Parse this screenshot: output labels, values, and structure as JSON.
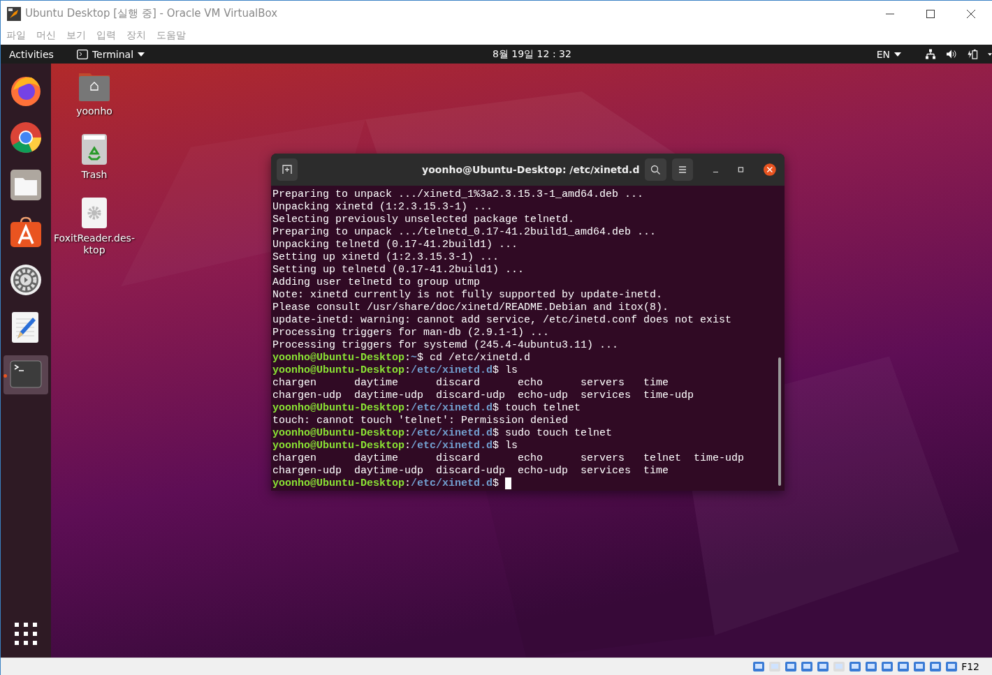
{
  "window": {
    "title": "Ubuntu Desktop [실행 중] - Oracle VM VirtualBox"
  },
  "menu": [
    "파일",
    "머신",
    "보기",
    "입력",
    "장치",
    "도움말"
  ],
  "top_bar": {
    "activities": "Activities",
    "app_menu": "Terminal",
    "clock": "8월 19일  12 : 32",
    "language": "EN"
  },
  "dock": [
    {
      "kind": "firefox",
      "selected": false
    },
    {
      "kind": "chrome",
      "selected": false
    },
    {
      "kind": "files",
      "selected": false
    },
    {
      "kind": "software",
      "selected": false
    },
    {
      "kind": "settings",
      "selected": false
    },
    {
      "kind": "editor",
      "selected": false
    },
    {
      "kind": "terminal",
      "selected": true
    }
  ],
  "desktop_icons": [
    {
      "kind": "home",
      "label": "yoonho"
    },
    {
      "kind": "trash",
      "label": "Trash"
    },
    {
      "kind": "file",
      "label": "FoxitReader.des-ktop"
    }
  ],
  "terminal": {
    "title": "yoonho@Ubuntu-Desktop: /etc/xinetd.d",
    "lines": [
      {
        "kind": "output",
        "text": "Preparing to unpack .../xinetd_1%3a2.3.15.3-1_amd64.deb ..."
      },
      {
        "kind": "output",
        "text": "Unpacking xinetd (1:2.3.15.3-1) ..."
      },
      {
        "kind": "output",
        "text": "Selecting previously unselected package telnetd."
      },
      {
        "kind": "output",
        "text": "Preparing to unpack .../telnetd_0.17-41.2build1_amd64.deb ..."
      },
      {
        "kind": "output",
        "text": "Unpacking telnetd (0.17-41.2build1) ..."
      },
      {
        "kind": "output",
        "text": "Setting up xinetd (1:2.3.15.3-1) ..."
      },
      {
        "kind": "output",
        "text": "Setting up telnetd (0.17-41.2build1) ..."
      },
      {
        "kind": "output",
        "text": "Adding user telnetd to group utmp"
      },
      {
        "kind": "output",
        "text": "Note: xinetd currently is not fully supported by update-inetd."
      },
      {
        "kind": "output",
        "text": "Please consult /usr/share/doc/xinetd/README.Debian and itox(8)."
      },
      {
        "kind": "output",
        "text": "update-inetd: warning: cannot add service, /etc/inetd.conf does not exist"
      },
      {
        "kind": "output",
        "text": "Processing triggers for man-db (2.9.1-1) ..."
      },
      {
        "kind": "output",
        "text": "Processing triggers for systemd (245.4-4ubuntu3.11) ..."
      },
      {
        "kind": "prompt",
        "user": "yoonho@Ubuntu-Desktop",
        "separator": ":",
        "path": "~",
        "command": "$ cd /etc/xinetd.d"
      },
      {
        "kind": "prompt",
        "user": "yoonho@Ubuntu-Desktop",
        "separator": ":",
        "path": "/etc/xinetd.d",
        "command": "$ ls"
      },
      {
        "kind": "output",
        "text": "chargen      daytime      discard      echo      servers   time"
      },
      {
        "kind": "output",
        "text": "chargen-udp  daytime-udp  discard-udp  echo-udp  services  time-udp"
      },
      {
        "kind": "prompt",
        "user": "yoonho@Ubuntu-Desktop",
        "separator": ":",
        "path": "/etc/xinetd.d",
        "command": "$ touch telnet"
      },
      {
        "kind": "output",
        "text": "touch: cannot touch 'telnet': Permission denied"
      },
      {
        "kind": "prompt",
        "user": "yoonho@Ubuntu-Desktop",
        "separator": ":",
        "path": "/etc/xinetd.d",
        "command": "$ sudo touch telnet"
      },
      {
        "kind": "prompt",
        "user": "yoonho@Ubuntu-Desktop",
        "separator": ":",
        "path": "/etc/xinetd.d",
        "command": "$ ls"
      },
      {
        "kind": "output",
        "text": "chargen      daytime      discard      echo      servers   telnet  time-udp"
      },
      {
        "kind": "output",
        "text": "chargen-udp  daytime-udp  discard-udp  echo-udp  services  time"
      },
      {
        "kind": "input",
        "user": "yoonho@Ubuntu-Desktop",
        "separator": ":",
        "path": "/etc/xinetd.d",
        "command": "$ "
      }
    ]
  },
  "status_bar": {
    "host_key": "F12"
  }
}
